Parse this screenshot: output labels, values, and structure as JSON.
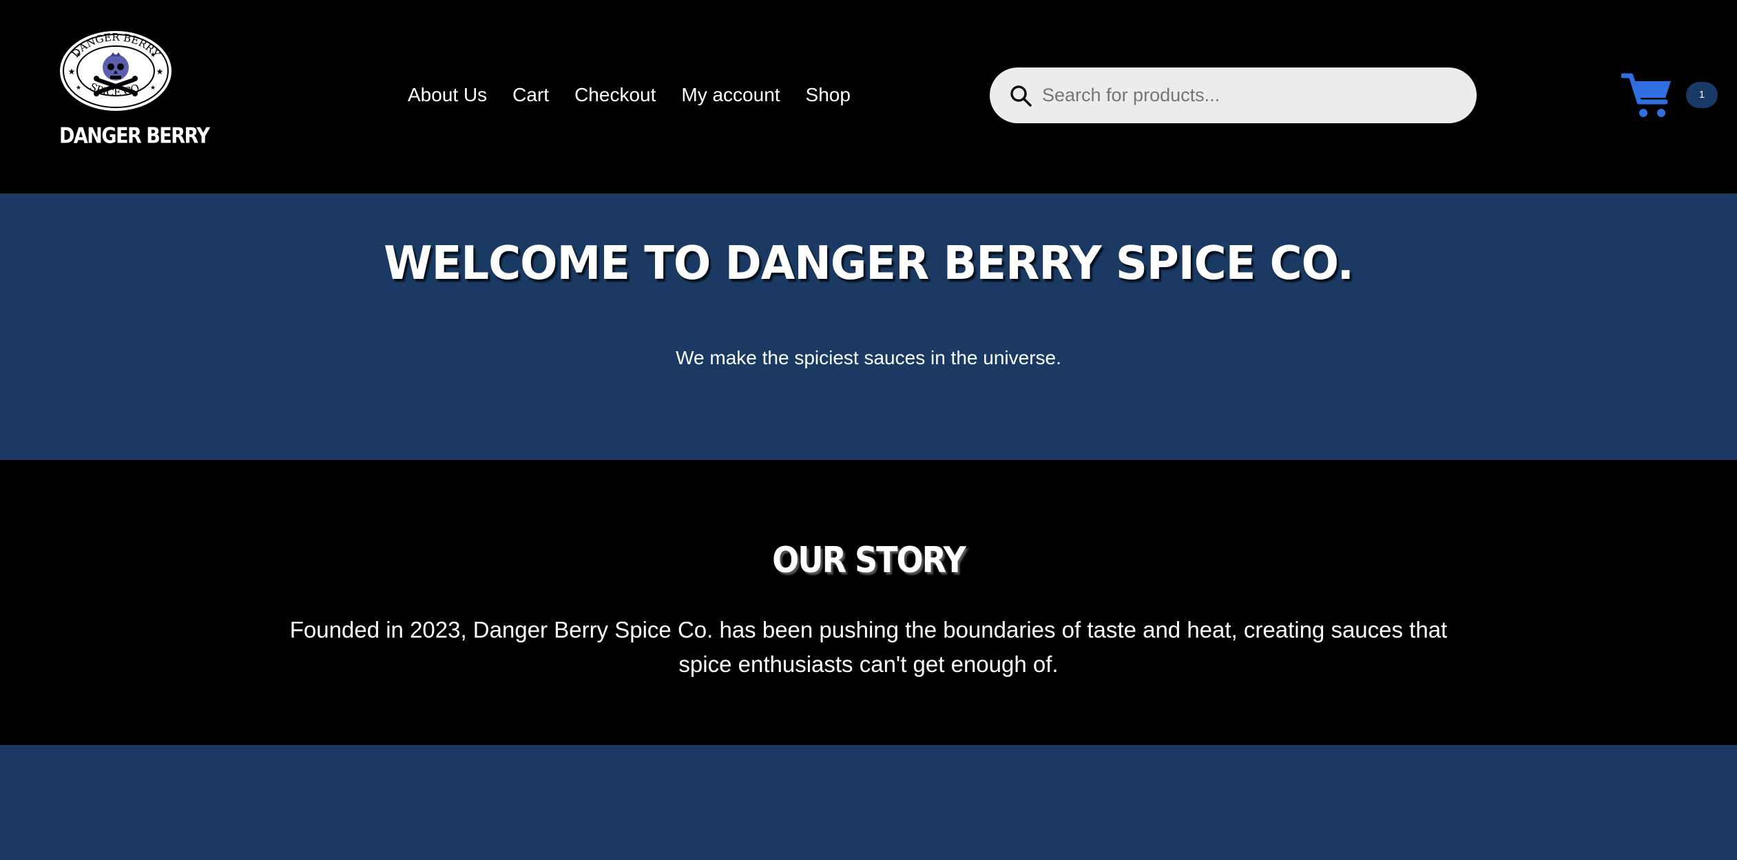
{
  "header": {
    "logo": {
      "emblem_text_top": "DANGER BERRY",
      "emblem_text_bottom": "SPICE CO.",
      "wordmark": "DANGER BERRY"
    },
    "nav": [
      {
        "label": "About Us"
      },
      {
        "label": "Cart"
      },
      {
        "label": "Checkout"
      },
      {
        "label": "My account"
      },
      {
        "label": "Shop"
      }
    ],
    "search": {
      "placeholder": "Search for products...",
      "value": ""
    },
    "cart": {
      "icon": "shopping-cart-icon",
      "count": "1",
      "color": "#2f6fe0"
    }
  },
  "hero": {
    "title": "Welcome to Danger Berry Spice Co.",
    "subtitle": "We make the spiciest sauces in the universe.",
    "background": "#1a3a63"
  },
  "story": {
    "title": "OUR STORY",
    "text": "Founded in 2023, Danger Berry Spice Co. has been pushing the boundaries of taste and heat, creating sauces that spice enthusiasts can't get enough of."
  },
  "colors": {
    "header_bg": "#000000",
    "band_blue": "#1a3a63",
    "accent_blue": "#2f6fe0"
  }
}
